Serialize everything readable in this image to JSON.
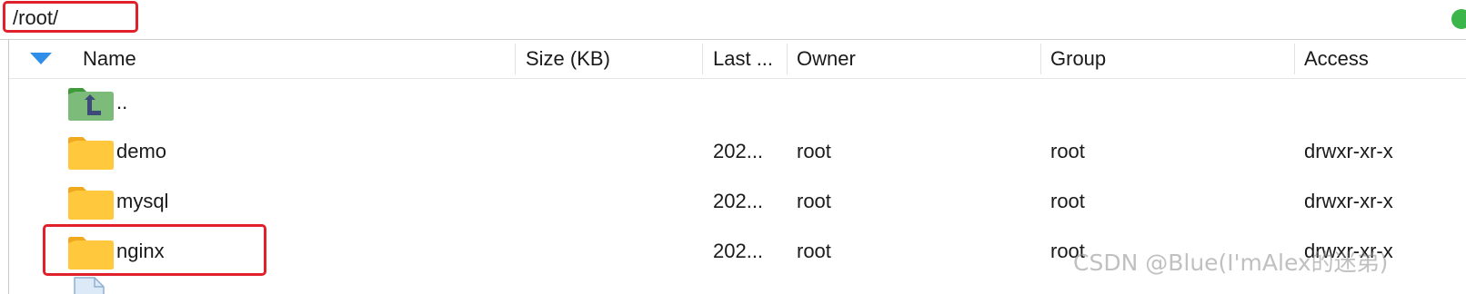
{
  "path_bar": {
    "value": "/root/"
  },
  "columns": [
    {
      "key": "name",
      "label": "Name"
    },
    {
      "key": "size",
      "label": "Size (KB)"
    },
    {
      "key": "modified",
      "label": "Last ..."
    },
    {
      "key": "owner",
      "label": "Owner"
    },
    {
      "key": "group",
      "label": "Group"
    },
    {
      "key": "access",
      "label": "Access"
    }
  ],
  "sort_indicator": "sort-descending-icon",
  "rows": [
    {
      "icon": "parent-folder-icon",
      "name": "..",
      "size": "",
      "modified": "",
      "owner": "",
      "group": "",
      "access": ""
    },
    {
      "icon": "folder-icon",
      "name": "demo",
      "size": "",
      "modified": "202...",
      "owner": "root",
      "group": "root",
      "access": "drwxr-xr-x"
    },
    {
      "icon": "folder-icon",
      "name": "mysql",
      "size": "",
      "modified": "202...",
      "owner": "root",
      "group": "root",
      "access": "drwxr-xr-x"
    },
    {
      "icon": "folder-icon",
      "name": "nginx",
      "size": "",
      "modified": "202...",
      "owner": "root",
      "group": "root",
      "access": "drwxr-xr-x"
    }
  ],
  "colors": {
    "highlight": "#e0202a",
    "folder": "#ffc83d",
    "parent_folder": "#7dbb7a",
    "sort_arrow": "#2f8fe8",
    "status_dot": "#3cb54a"
  },
  "watermark": "CSDN @Blue(I'mAlex的迷弟)"
}
